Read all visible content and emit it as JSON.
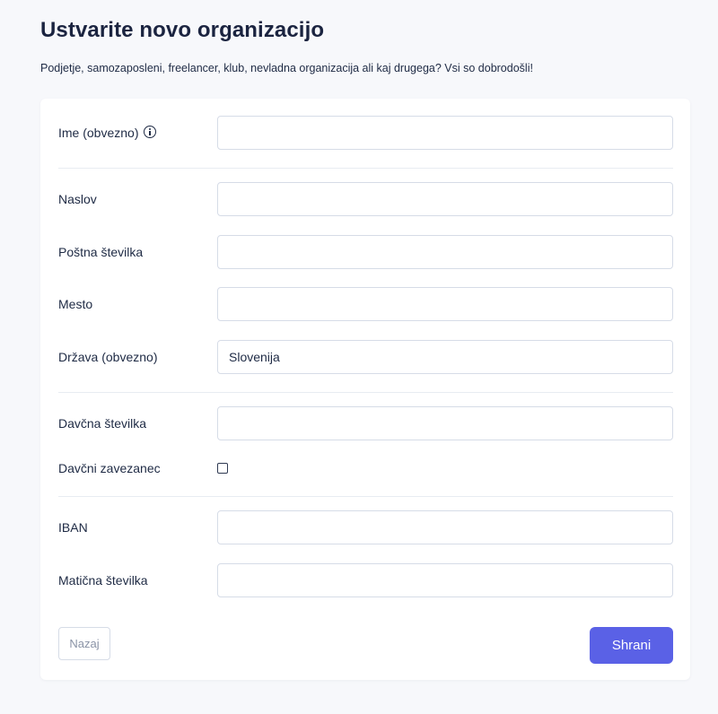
{
  "page": {
    "title": "Ustvarite novo organizacijo",
    "subtitle": "Podjetje, samozaposleni, freelancer, klub, nevladna organizacija ali kaj drugega? Vsi so dobrodošli!"
  },
  "form": {
    "fields": [
      {
        "label": "Ime (obvezno)",
        "value": "",
        "icon": "info-icon"
      },
      {
        "label": "Naslov",
        "value": ""
      },
      {
        "label": "Poštna številka",
        "value": ""
      },
      {
        "label": "Mesto",
        "value": ""
      },
      {
        "label": "Država (obvezno)",
        "value": "Slovenija"
      },
      {
        "label": "Davčna številka",
        "value": ""
      },
      {
        "label": "Davčni zavezanec",
        "checked": false
      },
      {
        "label": "IBAN",
        "value": ""
      },
      {
        "label": "Matična številka",
        "value": ""
      }
    ]
  },
  "actions": {
    "back_label": "Nazaj",
    "save_label": "Shrani"
  },
  "colors": {
    "accent": "#5a61e6",
    "background": "#f7f8fb",
    "card": "#ffffff",
    "border": "#d6dce7"
  }
}
